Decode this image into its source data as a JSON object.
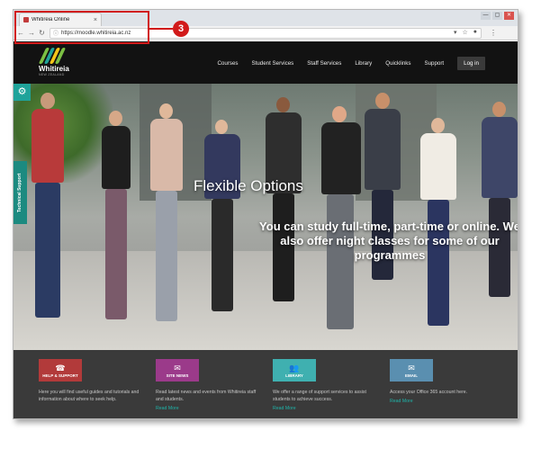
{
  "browser": {
    "tab_title": "Whitireia Online",
    "tab_close": "×",
    "url": "https://moodle.whitireia.ac.nz",
    "window_controls": [
      "—",
      "▢",
      "✕"
    ]
  },
  "callout": {
    "number": "3",
    "color": "#d11a1a"
  },
  "site": {
    "logo_name": "Whitireia",
    "logo_sub": "NEW ZEALAND",
    "nav": [
      "Courses",
      "Student Services",
      "Staff Services",
      "Library",
      "Quicklinks",
      "Support"
    ],
    "login_label": "Log in"
  },
  "hero": {
    "title": "Flexible Options",
    "subtitle": "You can study full-time, part-time or online. We also offer night classes for some of our programmes",
    "side_tab": "Technical Support"
  },
  "footer": {
    "items": [
      {
        "label": "HELP & SUPPORT",
        "icon": "telephone-icon",
        "color": "#b23a3a",
        "desc": "Here you will find useful guides and tutorials and information about where to seek help.",
        "more": ""
      },
      {
        "label": "SITE NEWS",
        "icon": "chat-icon",
        "color": "#9b3a8a",
        "desc": "Read latest news and events from Whitireia staff and students.",
        "more": "Read More"
      },
      {
        "label": "LIBRARY",
        "icon": "people-icon",
        "color": "#3fb0b0",
        "desc": "We offer a range of support services to assist students to achieve success.",
        "more": "Read More"
      },
      {
        "label": "EMAIL",
        "icon": "email-icon",
        "color": "#5a8fb0",
        "desc": "Access your Office 365 account here.",
        "more": "Read More"
      }
    ]
  },
  "colors": {
    "accent": "#1fa39a",
    "header_bg": "#121212",
    "footer_bg": "#3a3a3a"
  }
}
